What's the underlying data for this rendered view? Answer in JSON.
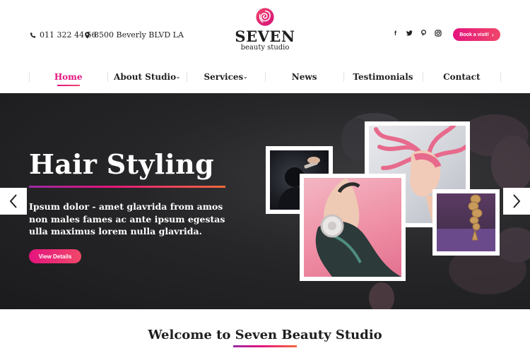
{
  "header": {
    "phone": "011 322 44 56",
    "address": "8500 Beverly BLVD LA",
    "logo": {
      "brand": "SEVEN",
      "tagline": "beauty studio"
    },
    "socials": [
      "facebook-icon",
      "twitter-icon",
      "pinterest-icon",
      "instagram-icon"
    ],
    "book_button": "Book a visit!"
  },
  "nav": {
    "items": [
      {
        "label": "Home",
        "active": true
      },
      {
        "label": "About Studio",
        "caret": "⌄"
      },
      {
        "label": "Services",
        "caret": "⌄"
      },
      {
        "label": "News"
      },
      {
        "label": "Testimonials"
      },
      {
        "label": "Contact"
      }
    ]
  },
  "hero": {
    "title": "Hair Styling",
    "text": "Ipsum dolor - amet glavrida from amos non males fames ac ante ipsum egestas ulla maximus lorem nulla glavrida.",
    "button": "View Details"
  },
  "welcome": {
    "title": "Welcome to Seven Beauty Studio"
  },
  "colors": {
    "accent": "#e4147e",
    "accent2": "#f0476a",
    "hero_bg": "#222224"
  }
}
